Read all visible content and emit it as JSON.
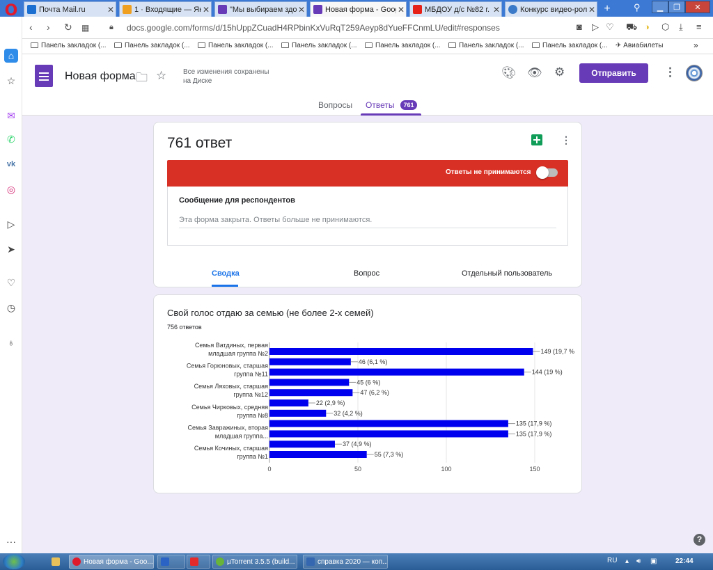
{
  "browser": {
    "tabs": [
      {
        "label": "Почта Mail.ru",
        "color": "#1a6fd1"
      },
      {
        "label": "1 · Входящие — Янде",
        "color": "#f0a020"
      },
      {
        "label": "\"Мы выбираем здор",
        "color": "#673ab7"
      },
      {
        "label": "Новая форма - Goog",
        "color": "#673ab7"
      },
      {
        "label": "МБДОУ д/с №82 г. Б",
        "color": "#e62117"
      },
      {
        "label": "Конкурс видео-роли",
        "color": "#3a7ac8"
      }
    ],
    "close_glyph": "✕",
    "new_tab_glyph": "+",
    "url": "docs.google.com/forms/d/15hUppZCuadH4RPbinKxVuRqT259Aeyp8dYueFFCnmLU/edit#responses",
    "bookmarks": [
      "Панель закладок (...",
      "Панель закладок (...",
      "Панель закладок (...",
      "Панель закладок (...",
      "Панель закладок (...",
      "Панель закладок (...",
      "Панель закладок (..."
    ],
    "aviabilety": "Авиабилеты",
    "more_glyph": "»"
  },
  "header": {
    "form_title": "Новая форма",
    "saved_line1": "Все изменения сохранены",
    "saved_line2": "на Диске",
    "send_label": "Отправить",
    "tab_questions": "Вопросы",
    "tab_answers": "Ответы",
    "answers_badge": "761"
  },
  "summary": {
    "count_title": "761 ответ",
    "not_accepting": "Ответы не принимаются",
    "message_title": "Сообщение для респондентов",
    "message_text": "Эта форма закрыта. Ответы больше не принимаются.",
    "subtabs": [
      "Сводка",
      "Вопрос",
      "Отдельный пользователь"
    ]
  },
  "question": {
    "title": "Свой голос отдаю за семью (не более 2-х семей)",
    "responses": "756 ответов"
  },
  "chart_data": {
    "type": "bar",
    "orientation": "horizontal",
    "bar_color": "#0000ee",
    "category_labels": [
      [
        "Семья Ватдиных, первая",
        "младшая группа №2"
      ],
      [
        "Семья Горюновых, старшая",
        "группа №11"
      ],
      [
        "Семья Ляховых, старшая",
        "группа №12"
      ],
      [
        "Семья Чирковых, средняя",
        "группа №8"
      ],
      [
        "Семья Завражиных, вторая",
        "младшая группа..."
      ],
      [
        "Семья Кочиных, старшая",
        "группа №1"
      ]
    ],
    "values": [
      149,
      46,
      144,
      45,
      47,
      22,
      32,
      135,
      135,
      37,
      55
    ],
    "data_labels": [
      "149 (19,7 %",
      "46 (6,1 %)",
      "144 (19 %)",
      "45 (6 %)",
      "47 (6,2 %)",
      "22 (2,9 %)",
      "32 (4,2 %)",
      "135 (17,9 %)",
      "135 (17,9 %)",
      "37 (4,9 %)",
      "55 (7,3 %)"
    ],
    "xlim": [
      0,
      150
    ],
    "xticks": [
      "0",
      "50",
      "100",
      "150"
    ],
    "grid": true
  },
  "taskbar": {
    "items": [
      {
        "label": "Новая форма - Goo...",
        "color": "#e01a2d"
      },
      {
        "label": "",
        "color": "#2b63c4"
      },
      {
        "label": "",
        "color": "#e32b2b"
      },
      {
        "label": "µTorrent 3.5.5 (build...",
        "color": "#68b33a"
      },
      {
        "label": "справка 2020 — коп...",
        "color": "#3567b0"
      }
    ],
    "lang": "RU",
    "time": "22:44"
  }
}
